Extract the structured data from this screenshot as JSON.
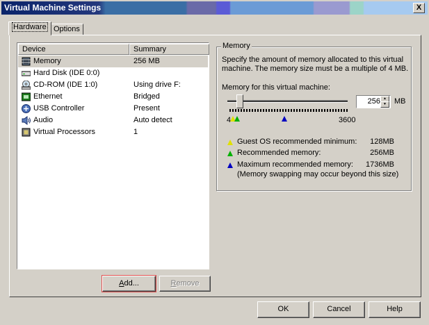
{
  "window": {
    "title": "Virtual Machine Settings",
    "close_glyph": "X"
  },
  "tabs": [
    {
      "label": "Hardware",
      "active": true
    },
    {
      "label": "Options",
      "active": false
    }
  ],
  "device_list": {
    "columns": [
      "Device",
      "Summary"
    ],
    "rows": [
      {
        "name": "Memory",
        "summary": "256 MB",
        "icon": "memory-icon",
        "selected": true
      },
      {
        "name": "Hard Disk (IDE 0:0)",
        "summary": "",
        "icon": "hard-disk-icon"
      },
      {
        "name": "CD-ROM (IDE 1:0)",
        "summary": "Using drive F:",
        "icon": "cdrom-icon"
      },
      {
        "name": "Ethernet",
        "summary": "Bridged",
        "icon": "ethernet-icon"
      },
      {
        "name": "USB Controller",
        "summary": "Present",
        "icon": "usb-icon"
      },
      {
        "name": "Audio",
        "summary": "Auto detect",
        "icon": "audio-icon"
      },
      {
        "name": "Virtual Processors",
        "summary": "1",
        "icon": "processor-icon"
      }
    ]
  },
  "list_buttons": {
    "add": "Add...",
    "remove": "Remove"
  },
  "memory": {
    "group_title": "Memory",
    "description": "Specify the amount of memory allocated to this virtual machine. The memory size must be a multiple of 4 MB.",
    "label": "Memory for this virtual machine:",
    "value": "256",
    "unit": "MB",
    "slider_min": "4",
    "slider_max": "3600",
    "legend": [
      {
        "text": "Guest OS recommended minimum:",
        "value": "128MB",
        "color": "#ffff00"
      },
      {
        "text": "Recommended memory:",
        "value": "256MB",
        "color": "#00cc00"
      },
      {
        "text": "Maximum recommended memory:",
        "value": "1736MB",
        "color": "#0000cc"
      }
    ],
    "note": "(Memory swapping may occur beyond this size)"
  },
  "footer": {
    "ok": "OK",
    "cancel": "Cancel",
    "help": "Help"
  }
}
